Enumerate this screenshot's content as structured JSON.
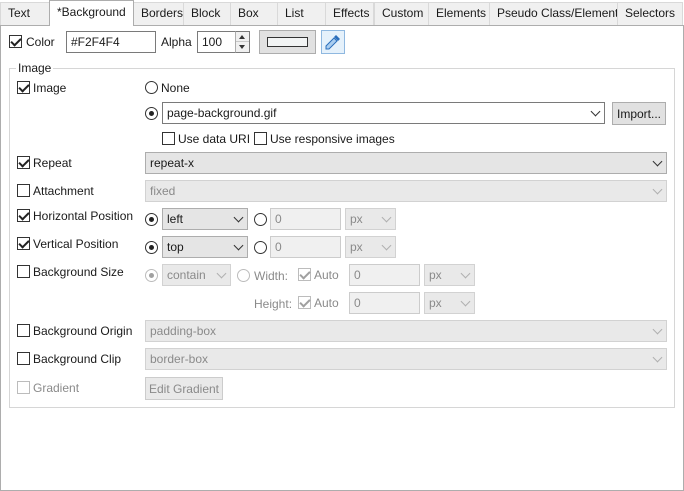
{
  "tabs": [
    {
      "label": "Text"
    },
    {
      "label": "*Background"
    },
    {
      "label": "Borders"
    },
    {
      "label": "Block"
    },
    {
      "label": "Box"
    },
    {
      "label": "List"
    },
    {
      "label": "Effects"
    },
    {
      "label": "Custom"
    },
    {
      "label": "Elements"
    },
    {
      "label": "Pseudo Class/Element"
    },
    {
      "label": "Selectors"
    }
  ],
  "color_row": {
    "color_label": "Color",
    "color_value": "#F2F4F4",
    "alpha_label": "Alpha",
    "alpha_value": "100",
    "swatch_color": "#F2F4F4",
    "picker_icon": "eyedropper-icon"
  },
  "image_group": {
    "title": "Image",
    "image_label": "Image",
    "none_label": "None",
    "file_value": "page-background.gif",
    "import_label": "Import...",
    "use_data_uri_label": "Use data URI",
    "use_responsive_label": "Use responsive images",
    "repeat_label": "Repeat",
    "repeat_value": "repeat-x",
    "attachment_label": "Attachment",
    "attachment_value": "fixed",
    "hpos_label": "Horizontal Position",
    "hpos_value": "left",
    "hpos_number": "0",
    "hpos_unit": "px",
    "vpos_label": "Vertical Position",
    "vpos_value": "top",
    "vpos_number": "0",
    "vpos_unit": "px",
    "bgsize_label": "Background Size",
    "bgsize_value": "contain",
    "width_label": "Width:",
    "height_label": "Height:",
    "auto_label": "Auto",
    "width_number": "0",
    "height_number": "0",
    "size_unit": "px",
    "origin_label": "Background Origin",
    "origin_value": "padding-box",
    "clip_label": "Background Clip",
    "clip_value": "border-box",
    "gradient_label": "Gradient",
    "edit_gradient_label": "Edit Gradient"
  }
}
